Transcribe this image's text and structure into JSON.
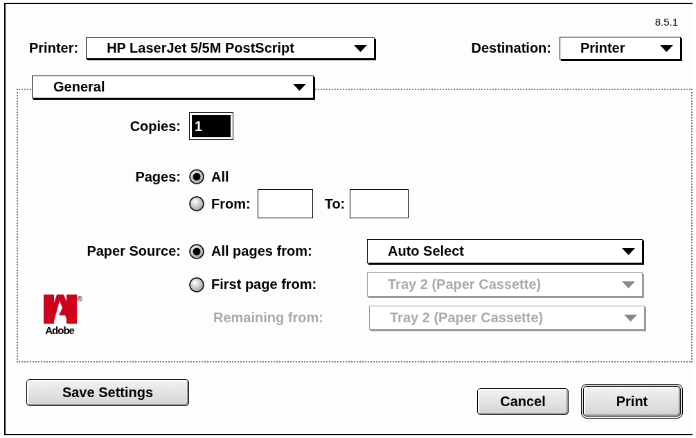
{
  "window": {
    "version": "8.5.1"
  },
  "printer": {
    "label": "Printer:",
    "value": "HP LaserJet 5/5M PostScript"
  },
  "destination": {
    "label": "Destination:",
    "value": "Printer"
  },
  "panel_menu": {
    "value": "General"
  },
  "copies": {
    "label": "Copies:",
    "value": "1",
    "selected": true
  },
  "pages": {
    "label": "Pages:",
    "options": [
      {
        "kind": "all",
        "label": "All",
        "selected": true
      },
      {
        "kind": "range",
        "label": "From:",
        "selected": false,
        "to_label": "To:"
      }
    ]
  },
  "paper_source": {
    "label": "Paper Source:",
    "rows": [
      {
        "kind": "radio",
        "label": "All pages from:",
        "selected": true,
        "popup": {
          "value": "Auto Select",
          "disabled": false
        }
      },
      {
        "kind": "radio",
        "label": "First page from:",
        "selected": false,
        "popup": {
          "value": "Tray 2 (Paper Cassette)",
          "disabled": true
        }
      },
      {
        "kind": "plain",
        "label": "Remaining from:",
        "disabled": true,
        "popup": {
          "value": "Tray 2 (Paper Cassette)",
          "disabled": true
        }
      }
    ]
  },
  "logo": {
    "mark": "®",
    "text": "Adobe"
  },
  "footer": {
    "left": [
      {
        "label": "Save Settings",
        "default": false
      }
    ],
    "right": [
      {
        "label": "Cancel",
        "default": false
      },
      {
        "label": "Print",
        "default": true
      }
    ]
  }
}
